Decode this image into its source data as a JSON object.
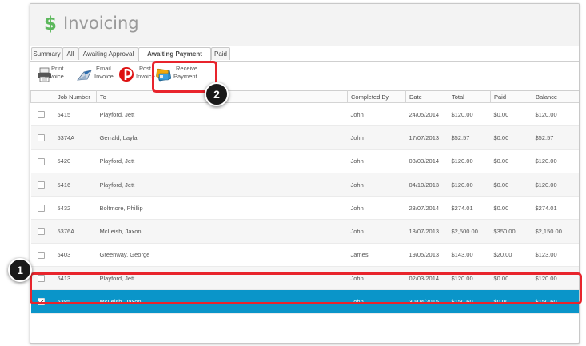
{
  "header": {
    "dollar_glyph": "$",
    "title": "Invoicing"
  },
  "tabs": [
    {
      "label": "Summary",
      "active": false
    },
    {
      "label": "All",
      "active": false
    },
    {
      "label": "Awaiting Approval",
      "active": false
    },
    {
      "label": "Awaiting Payment",
      "active": true
    },
    {
      "label": "Paid",
      "active": false
    }
  ],
  "toolbar": {
    "print": {
      "line1": "Print",
      "line2": "Invoice"
    },
    "email": {
      "line1": "Email",
      "line2": "Invoice"
    },
    "post": {
      "line1": "Post",
      "line2": "Invoice"
    },
    "receive": {
      "line1": "Receive",
      "line2": "Payment"
    }
  },
  "table": {
    "columns": [
      "",
      "Job Number",
      "To",
      "Completed By",
      "Date",
      "Total",
      "Paid",
      "Balance"
    ],
    "rows": [
      {
        "checked": false,
        "job": "5415",
        "to": "Playford, Jett",
        "by": "John",
        "date": "24/05/2014",
        "total": "$120.00",
        "paid": "$0.00",
        "balance": "$120.00"
      },
      {
        "checked": false,
        "job": "5374A",
        "to": "Gerrald, Layla",
        "by": "John",
        "date": "17/07/2013",
        "total": "$52.57",
        "paid": "$0.00",
        "balance": "$52.57"
      },
      {
        "checked": false,
        "job": "5420",
        "to": "Playford, Jett",
        "by": "John",
        "date": "03/03/2014",
        "total": "$120.00",
        "paid": "$0.00",
        "balance": "$120.00"
      },
      {
        "checked": false,
        "job": "5416",
        "to": "Playford, Jett",
        "by": "John",
        "date": "04/10/2013",
        "total": "$120.00",
        "paid": "$0.00",
        "balance": "$120.00"
      },
      {
        "checked": false,
        "job": "5432",
        "to": "Boltmore, Phillip",
        "by": "John",
        "date": "23/07/2014",
        "total": "$274.01",
        "paid": "$0.00",
        "balance": "$274.01"
      },
      {
        "checked": false,
        "job": "5376A",
        "to": "McLeish, Jaxon",
        "by": "John",
        "date": "18/07/2013",
        "total": "$2,500.00",
        "paid": "$350.00",
        "balance": "$2,150.00"
      },
      {
        "checked": false,
        "job": "5403",
        "to": "Greenway, George",
        "by": "James",
        "date": "19/05/2013",
        "total": "$143.00",
        "paid": "$20.00",
        "balance": "$123.00"
      },
      {
        "checked": false,
        "job": "5413",
        "to": "Playford, Jett",
        "by": "John",
        "date": "02/03/2014",
        "total": "$120.00",
        "paid": "$0.00",
        "balance": "$120.00"
      },
      {
        "checked": true,
        "job": "5385",
        "to": "McLeish, Jaxon",
        "by": "John",
        "date": "30/04/2015",
        "total": "$150.60",
        "paid": "$0.00",
        "balance": "$150.60"
      }
    ]
  },
  "callouts": {
    "step1": "1",
    "step2": "2"
  },
  "colors": {
    "accent": "#5cb85c",
    "selection": "#0a95c9",
    "callout": "#e8242c"
  }
}
